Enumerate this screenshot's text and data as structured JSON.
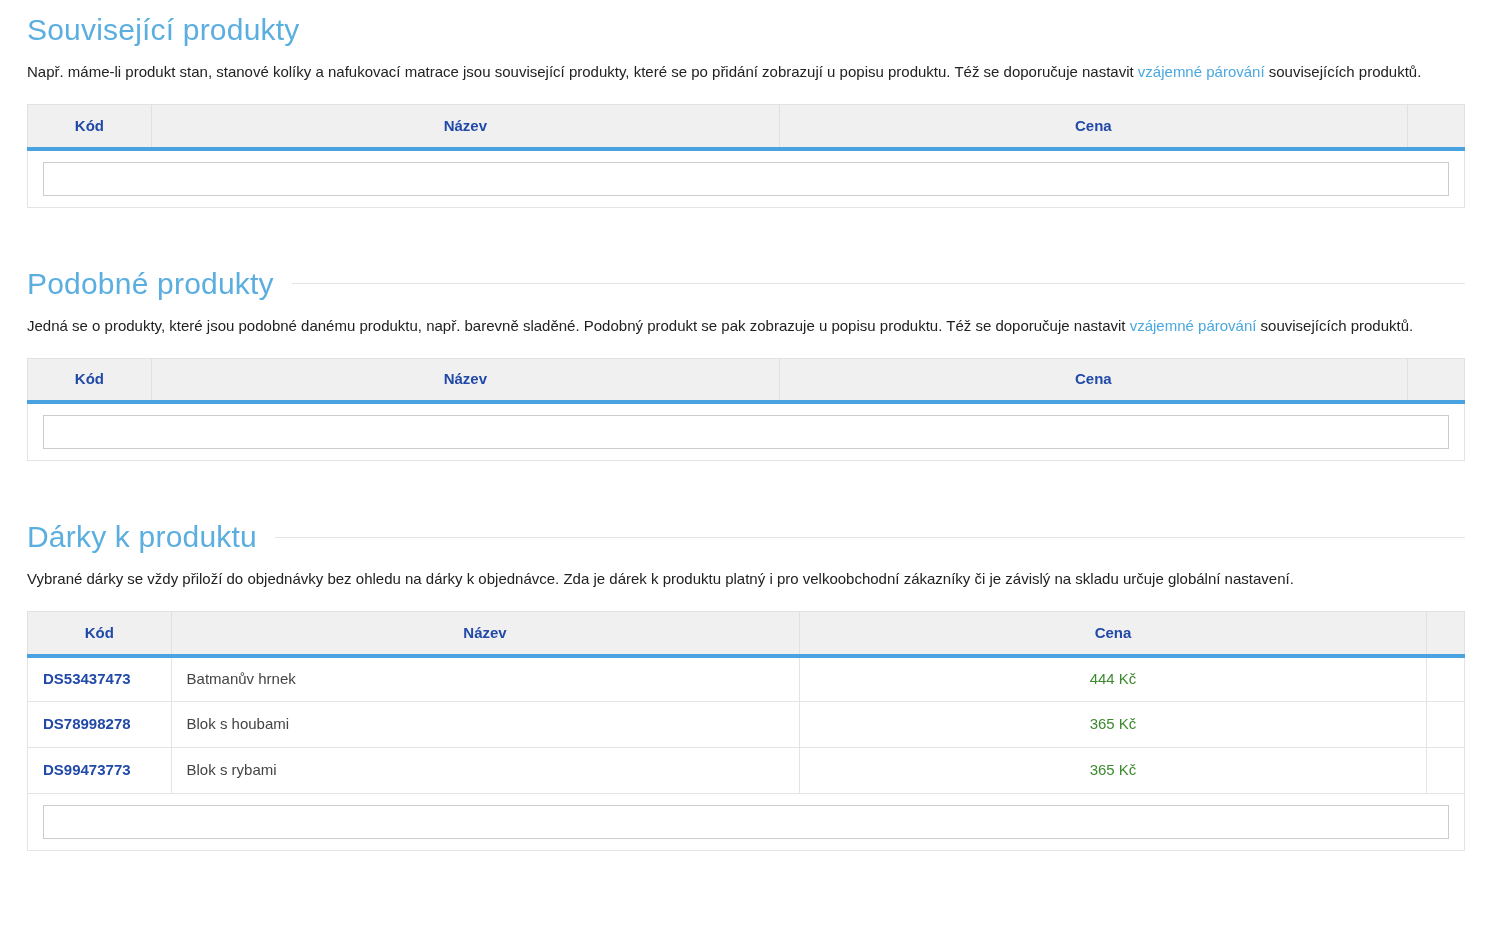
{
  "sections": [
    {
      "title": "Související produkty",
      "divider": false,
      "description": {
        "before": "Např. máme-li produkt stan, stanové kolíky a nafukovací matrace jsou související produkty, které se po přidání zobrazují u popisu produktu. Též se doporučuje nastavit",
        "link": "vzájemné párování",
        "after": "souvisejících produktů."
      },
      "table": {
        "columns": [
          "Kód",
          "Název",
          "Cena"
        ]
      }
    },
    {
      "title": "Podobné produkty",
      "divider": true,
      "description": {
        "before": "Jedná se o produkty, které jsou podobné danému produktu, např. barevně sladěné. Podobný produkt se pak zobrazuje u popisu produktu. Též se doporučuje nastavit",
        "link": "vzájemné párování",
        "after": "souvisejících produktů."
      },
      "table": {
        "columns": [
          "Kód",
          "Název",
          "Cena"
        ]
      }
    },
    {
      "title": "Dárky k produktu",
      "divider": true,
      "description": {
        "before": "Vybrané dárky se vždy přiloží do objednávky bez ohledu na dárky k objednávce. Zda je dárek k produktu platný i pro velkoobchodní zákazníky či je závislý na skladu určuje globální nastavení."
      },
      "table": {
        "columns": [
          "Kód",
          "Název",
          "Cena"
        ],
        "rows": [
          {
            "code": "DS53437473",
            "name": "Batmanův hrnek",
            "price": "444 Kč"
          },
          {
            "code": "DS78998278",
            "name": "Blok s houbami",
            "price": "365 Kč"
          },
          {
            "code": "DS99473773",
            "name": "Blok s rybami",
            "price": "365 Kč"
          }
        ]
      }
    }
  ]
}
